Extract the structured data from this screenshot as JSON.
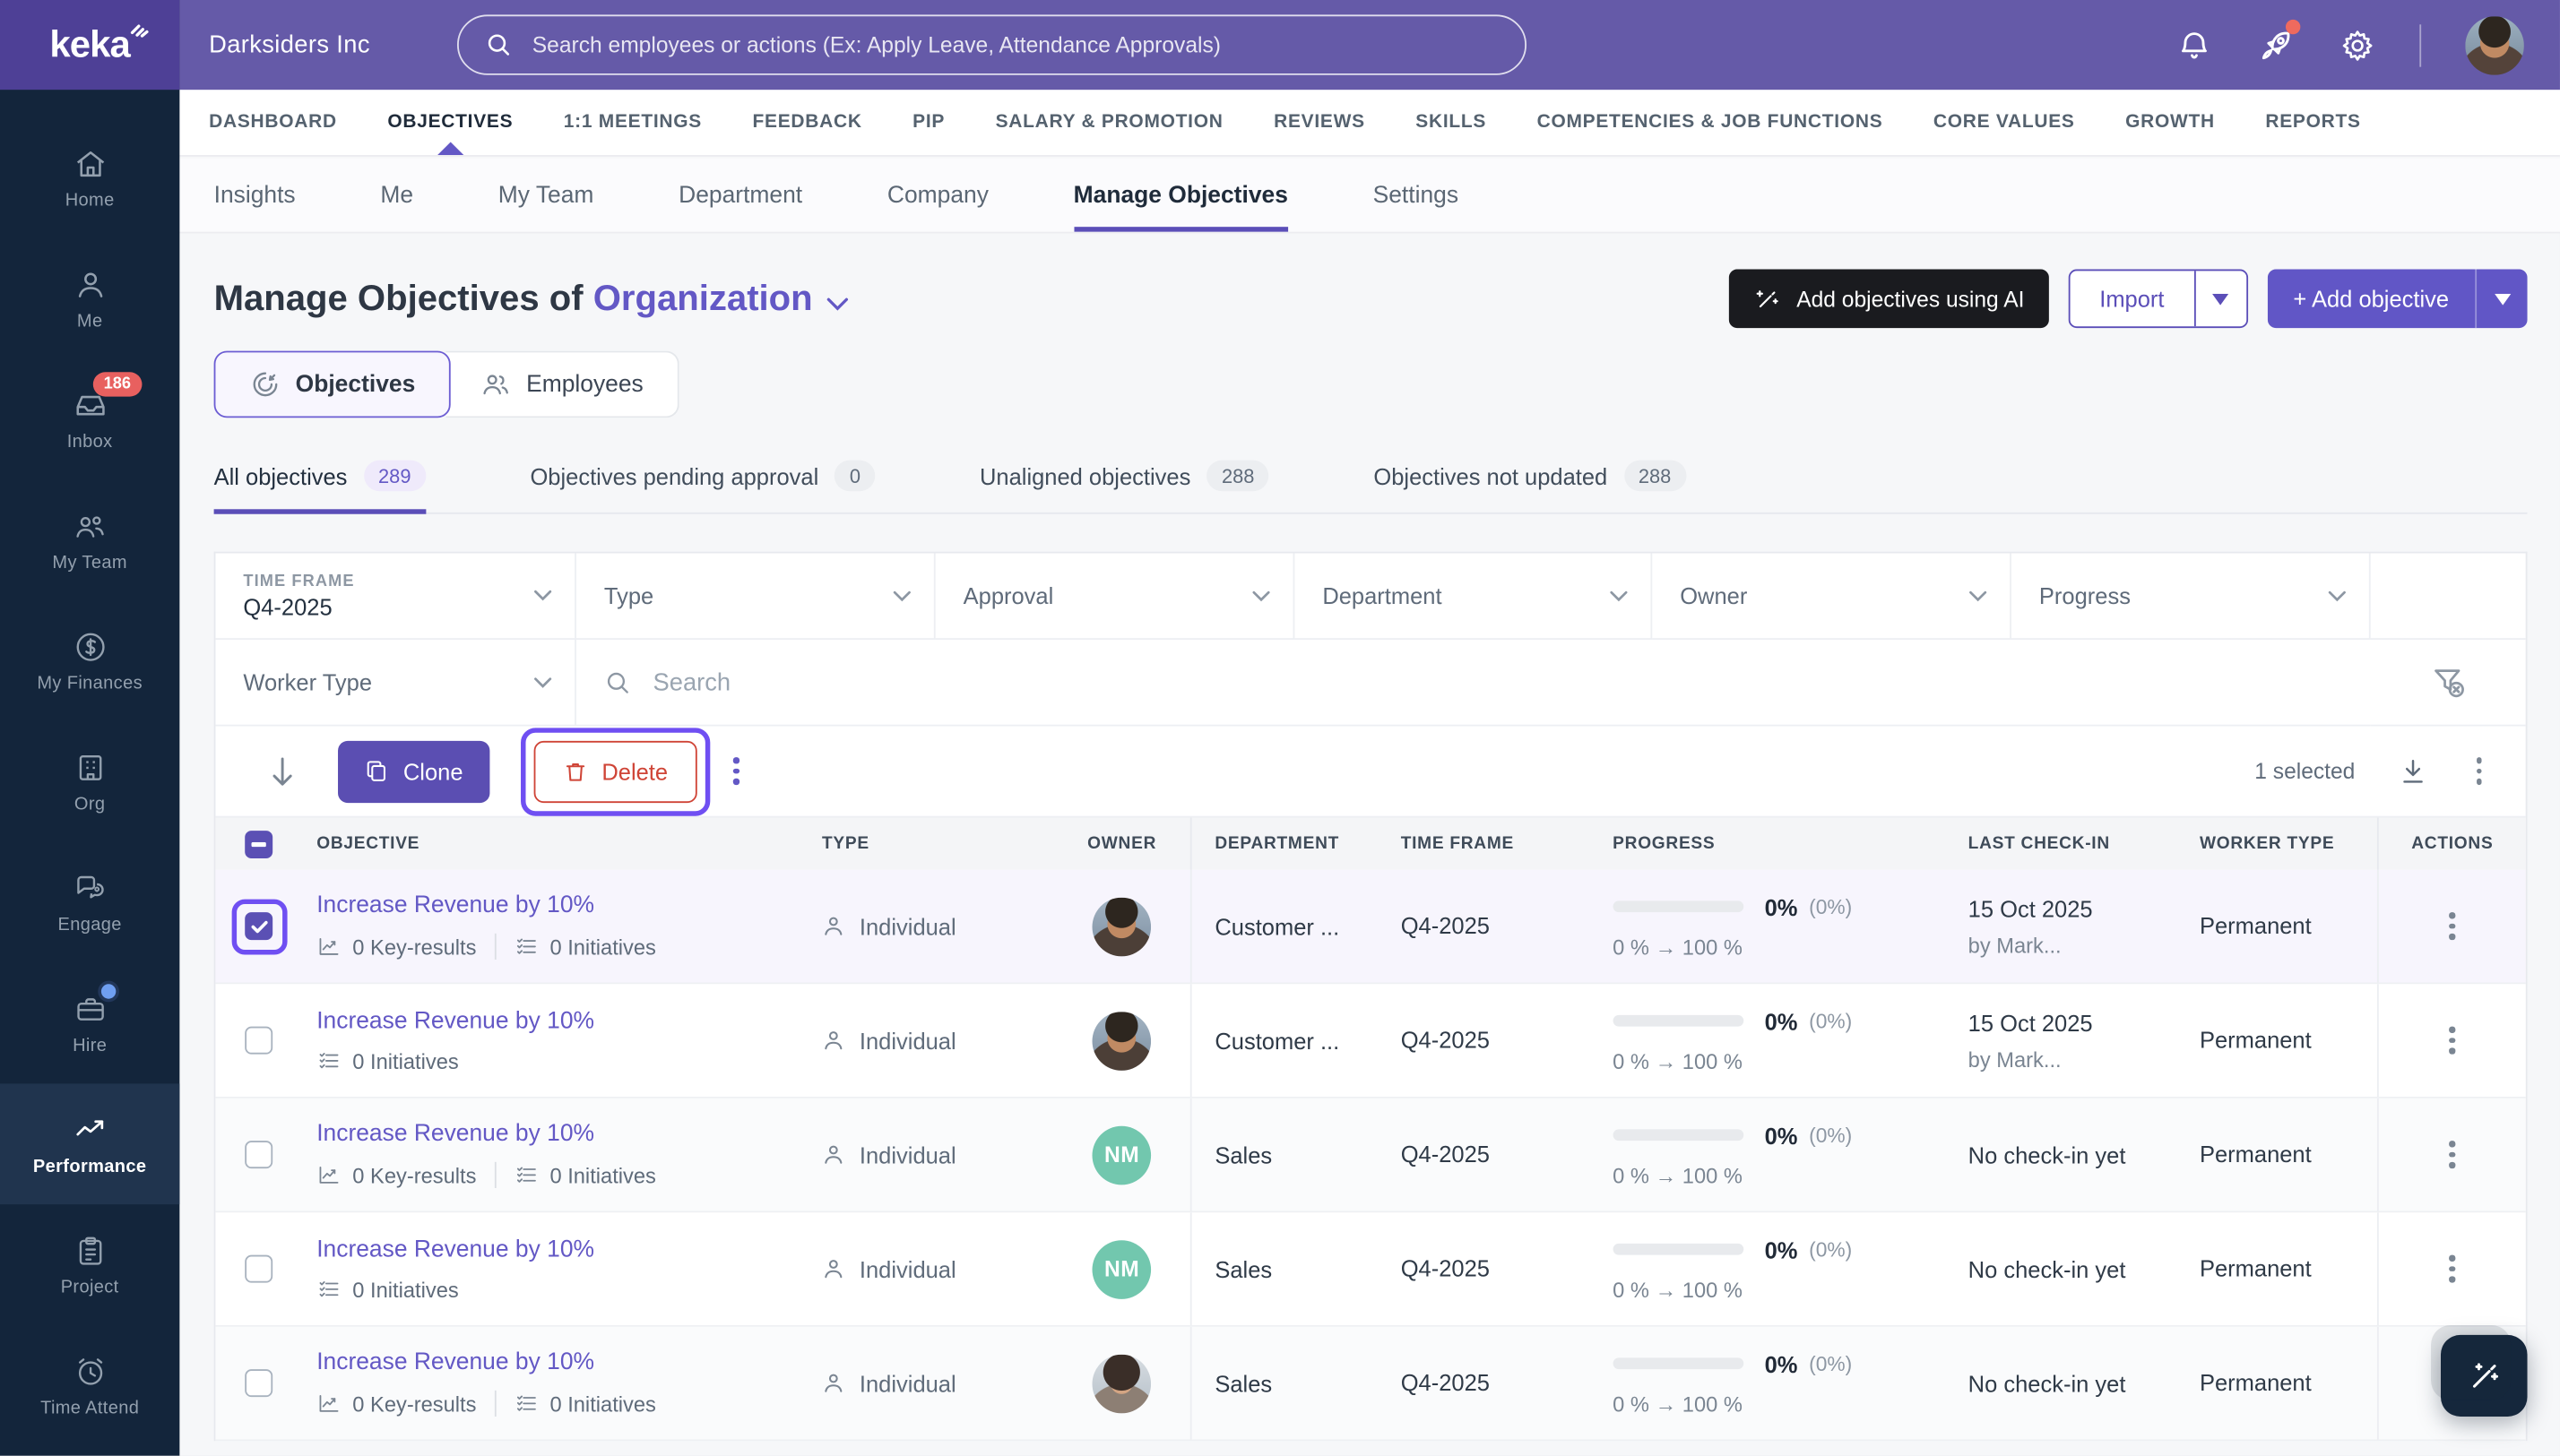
{
  "colors": {
    "accent": "#6358c5",
    "topbar": "#655aa8",
    "sidebar": "#13253b",
    "danger": "#cf4436",
    "highlight": "#6f4ff2",
    "avatar_initials_bg": "#72c7ae"
  },
  "topbar": {
    "logo": "keka",
    "company": "Darksiders Inc",
    "search_placeholder": "Search employees or actions (Ex: Apply Leave, Attendance Approvals)"
  },
  "sidebar": {
    "items": [
      {
        "label": "Home"
      },
      {
        "label": "Me"
      },
      {
        "label": "Inbox",
        "badge": "186"
      },
      {
        "label": "My Team"
      },
      {
        "label": "My Finances"
      },
      {
        "label": "Org"
      },
      {
        "label": "Engage"
      },
      {
        "label": "Hire"
      },
      {
        "label": "Performance"
      },
      {
        "label": "Project"
      },
      {
        "label": "Time Attend"
      }
    ]
  },
  "main_nav": {
    "items": [
      {
        "label": "DASHBOARD"
      },
      {
        "label": "OBJECTIVES"
      },
      {
        "label": "1:1 MEETINGS"
      },
      {
        "label": "FEEDBACK"
      },
      {
        "label": "PIP"
      },
      {
        "label": "SALARY & PROMOTION"
      },
      {
        "label": "REVIEWS"
      },
      {
        "label": "SKILLS"
      },
      {
        "label": "COMPETENCIES & JOB FUNCTIONS"
      },
      {
        "label": "CORE VALUES"
      },
      {
        "label": "GROWTH"
      },
      {
        "label": "REPORTS"
      }
    ]
  },
  "sub_nav": {
    "items": [
      {
        "label": "Insights"
      },
      {
        "label": "Me"
      },
      {
        "label": "My Team"
      },
      {
        "label": "Department"
      },
      {
        "label": "Company"
      },
      {
        "label": "Manage Objectives"
      },
      {
        "label": "Settings"
      }
    ]
  },
  "page": {
    "title_prefix": "Manage Objectives of",
    "title_entity": "Organization",
    "ai_button": "Add objectives using AI",
    "import_label": "Import",
    "add_objective_label": "+ Add objective"
  },
  "view_toggle": {
    "objectives": "Objectives",
    "employees": "Employees"
  },
  "tabs": [
    {
      "label": "All objectives",
      "count": "289"
    },
    {
      "label": "Objectives pending approval",
      "count": "0"
    },
    {
      "label": "Unaligned objectives",
      "count": "288"
    },
    {
      "label": "Objectives not updated",
      "count": "288"
    }
  ],
  "filters": {
    "time_frame_label": "TIME FRAME",
    "time_frame_value": "Q4-2025",
    "type": "Type",
    "approval": "Approval",
    "department": "Department",
    "owner": "Owner",
    "progress": "Progress",
    "worker_type": "Worker Type",
    "search_placeholder": "Search"
  },
  "toolbar": {
    "clone": "Clone",
    "delete": "Delete",
    "selected": "1 selected"
  },
  "table": {
    "columns": [
      "OBJECTIVE",
      "TYPE",
      "OWNER",
      "DEPARTMENT",
      "TIME FRAME",
      "PROGRESS",
      "LAST CHECK-IN",
      "WORKER TYPE",
      "ACTIONS"
    ],
    "rows": [
      {
        "title": "Increase Revenue by 10%",
        "key_results": "0 Key-results",
        "initiatives": "0 Initiatives",
        "type": "Individual",
        "owner_initials": "",
        "department": "Customer ...",
        "time_frame": "Q4-2025",
        "progress_pct": "0%",
        "progress_paren": "(0%)",
        "progress_range": "0 % → 100 %",
        "checkin_1": "15 Oct 2025",
        "checkin_2": "by Mark...",
        "worker_type": "Permanent"
      },
      {
        "title": "Increase Revenue by 10%",
        "key_results": "",
        "initiatives": "0 Initiatives",
        "type": "Individual",
        "owner_initials": "",
        "department": "Customer ...",
        "time_frame": "Q4-2025",
        "progress_pct": "0%",
        "progress_paren": "(0%)",
        "progress_range": "0 % → 100 %",
        "checkin_1": "15 Oct 2025",
        "checkin_2": "by Mark...",
        "worker_type": "Permanent"
      },
      {
        "title": "Increase Revenue by 10%",
        "key_results": "0 Key-results",
        "initiatives": "0 Initiatives",
        "type": "Individual",
        "owner_initials": "NM",
        "department": "Sales",
        "time_frame": "Q4-2025",
        "progress_pct": "0%",
        "progress_paren": "(0%)",
        "progress_range": "0 % → 100 %",
        "checkin_1": "No check-in yet",
        "checkin_2": "",
        "worker_type": "Permanent"
      },
      {
        "title": "Increase Revenue by 10%",
        "key_results": "",
        "initiatives": "0 Initiatives",
        "type": "Individual",
        "owner_initials": "NM",
        "department": "Sales",
        "time_frame": "Q4-2025",
        "progress_pct": "0%",
        "progress_paren": "(0%)",
        "progress_range": "0 % → 100 %",
        "checkin_1": "No check-in yet",
        "checkin_2": "",
        "worker_type": "Permanent"
      },
      {
        "title": "Increase Revenue by 10%",
        "key_results": "0 Key-results",
        "initiatives": "0 Initiatives",
        "type": "Individual",
        "owner_initials": "",
        "department": "Sales",
        "time_frame": "Q4-2025",
        "progress_pct": "0%",
        "progress_paren": "(0%)",
        "progress_range": "0 % → 100 %",
        "checkin_1": "No check-in yet",
        "checkin_2": "",
        "worker_type": "Permanent"
      }
    ]
  }
}
